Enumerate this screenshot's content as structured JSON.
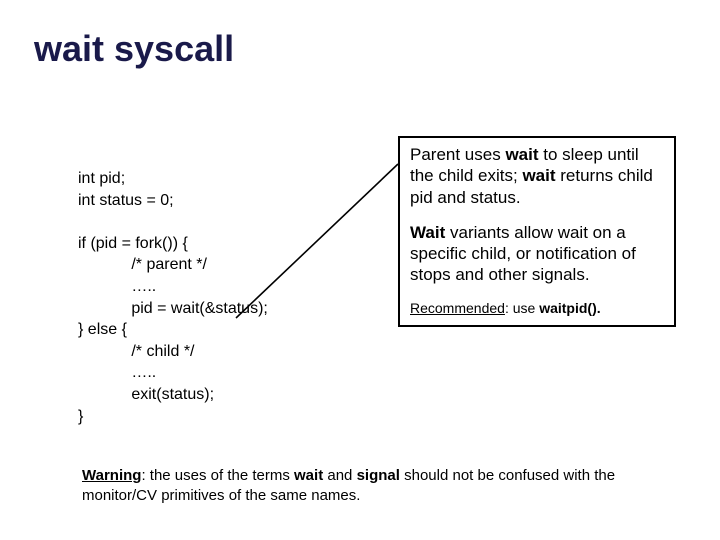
{
  "title": "wait syscall",
  "code": {
    "l1": "int pid;",
    "l2": "int status = 0;",
    "l3": "if (pid = fork()) {",
    "l4": "/* parent */",
    "l5": "…..",
    "l6": "pid = wait(&status);",
    "l7": "} else {",
    "l8": "/* child */",
    "l9": "…..",
    "l10": "exit(status);",
    "l11": "}"
  },
  "callout": {
    "p1_a": "Parent uses ",
    "p1_b": "wait",
    "p1_c": " to sleep until the child exits; ",
    "p1_d": "wait",
    "p1_e": " returns child pid and status.",
    "p2_a": "Wait",
    "p2_b": " variants allow wait on a specific child, or notification of stops and other signals.",
    "rec_a": "Recommended",
    "rec_b": ": use ",
    "rec_c": "waitpid().",
    "rec_d": ""
  },
  "warning": {
    "a": "Warning",
    "b": ": the uses of the terms ",
    "c": "wait",
    "d": " and ",
    "e": "signal",
    "f": " should not be confused with the monitor/CV primitives of the same names."
  }
}
